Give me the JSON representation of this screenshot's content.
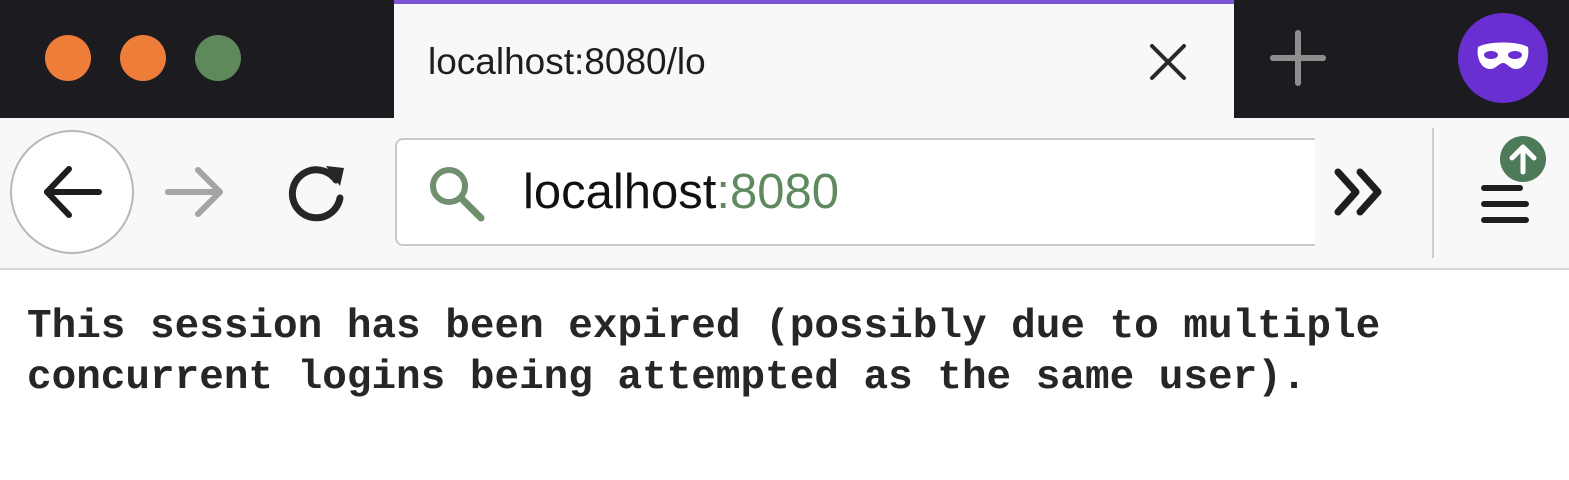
{
  "window": {
    "traffic_lights": {
      "close_color": "#ee7d3a",
      "minimize_color": "#ee7d3a",
      "zoom_color": "#5e8a5b"
    },
    "private_badge_icon": "private-browsing-mask-icon"
  },
  "tab": {
    "title": "localhost:8080/lo",
    "close_icon": "close-icon",
    "new_tab_icon": "plus-icon"
  },
  "toolbar": {
    "back_icon": "back-arrow-icon",
    "forward_icon": "forward-arrow-icon",
    "reload_icon": "reload-icon",
    "overflow_icon": "double-chevron-right-icon",
    "menu_icon": "hamburger-menu-icon",
    "update_badge_icon": "arrow-up-icon"
  },
  "urlbar": {
    "search_icon": "search-icon",
    "host": "localhost",
    "port": ":8080"
  },
  "page": {
    "message": "This session has been expired (possibly due to multiple concurrent logins being attempted as the same user)."
  },
  "colors": {
    "accent_tab_border": "#7b57d6",
    "private_badge": "#6a2fd1",
    "update_badge": "#4d7a58",
    "url_port": "#5f8a5f"
  }
}
